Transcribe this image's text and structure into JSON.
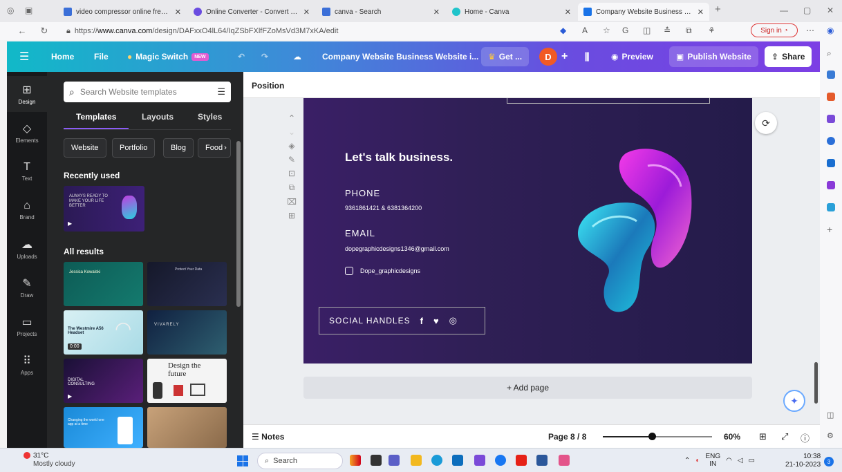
{
  "browser": {
    "tabs": [
      {
        "label": "video compressor online free - S",
        "active": false
      },
      {
        "label": "Online Converter - Convert Imag",
        "active": false
      },
      {
        "label": "canva - Search",
        "active": false
      },
      {
        "label": "Home - Canva",
        "active": false
      },
      {
        "label": "Company Website Business Web",
        "active": true
      }
    ],
    "url_prefix": "https://",
    "url_domain": "www.canva.com",
    "url_path": "/design/DAFxxO4lL64/IqZSbFXlfFZoMsVd3M7xKA/edit",
    "signin_label": "Sign in"
  },
  "toolbar": {
    "home": "Home",
    "file": "File",
    "magic_switch": "Magic Switch",
    "new_badge": "NEW",
    "title": "Company Website Business Website i...",
    "get": "Get ...",
    "avatar_letter": "D",
    "preview": "Preview",
    "publish": "Publish Website",
    "share": "Share"
  },
  "rail": [
    {
      "label": "Design",
      "icon": "design-icon"
    },
    {
      "label": "Elements",
      "icon": "elements-icon"
    },
    {
      "label": "Text",
      "icon": "text-icon"
    },
    {
      "label": "Brand",
      "icon": "brand-icon"
    },
    {
      "label": "Uploads",
      "icon": "uploads-icon"
    },
    {
      "label": "Draw",
      "icon": "draw-icon"
    },
    {
      "label": "Projects",
      "icon": "projects-icon"
    },
    {
      "label": "Apps",
      "icon": "apps-icon"
    }
  ],
  "panel": {
    "search_placeholder": "Search Website templates",
    "tabs": [
      "Templates",
      "Layouts",
      "Styles"
    ],
    "chips": [
      "Website",
      "Portfolio",
      "Blog",
      "Food"
    ],
    "recently_used": "Recently used",
    "recent_thumb_text": "ALWAYS READY TO MAKE YOUR LIFE BETTER",
    "all_results": "All results",
    "thumbs": [
      {
        "text": "Jessica Kowalski"
      },
      {
        "text": "Protect Your Data"
      },
      {
        "text": "The Westmire A56 Headset",
        "badge": "0:00"
      },
      {
        "text": "VIVARELY"
      },
      {
        "text": "DIGITAL CONSULTING"
      },
      {
        "text": "Design the future"
      },
      {
        "text": "Changing the world one app at a time"
      },
      {
        "text": ""
      }
    ]
  },
  "canvas": {
    "position_label": "Position",
    "headline": "Let's talk business.",
    "phone_heading": "PHONE",
    "phone_value": "9361861421 & 6381364200",
    "email_heading": "EMAIL",
    "email_value": "dopegraphicdesigns1346@gmail.com",
    "instagram_handle": "Dope_graphicdesigns",
    "social_label": "SOCIAL HANDLES",
    "add_page": "+ Add page",
    "page_colors": {
      "bg_start": "#3a1f66",
      "bg_end": "#241b4a"
    }
  },
  "footer": {
    "notes": "Notes",
    "page_indicator": "Page 8 / 8",
    "zoom": "60%",
    "zoom_fraction": 0.45
  },
  "taskbar": {
    "temperature": "31°C",
    "weather": "Mostly cloudy",
    "search_placeholder": "Search",
    "lang_1": "ENG",
    "lang_2": "IN",
    "time": "10:38",
    "date": "21-10-2023",
    "notif_count": "3"
  }
}
